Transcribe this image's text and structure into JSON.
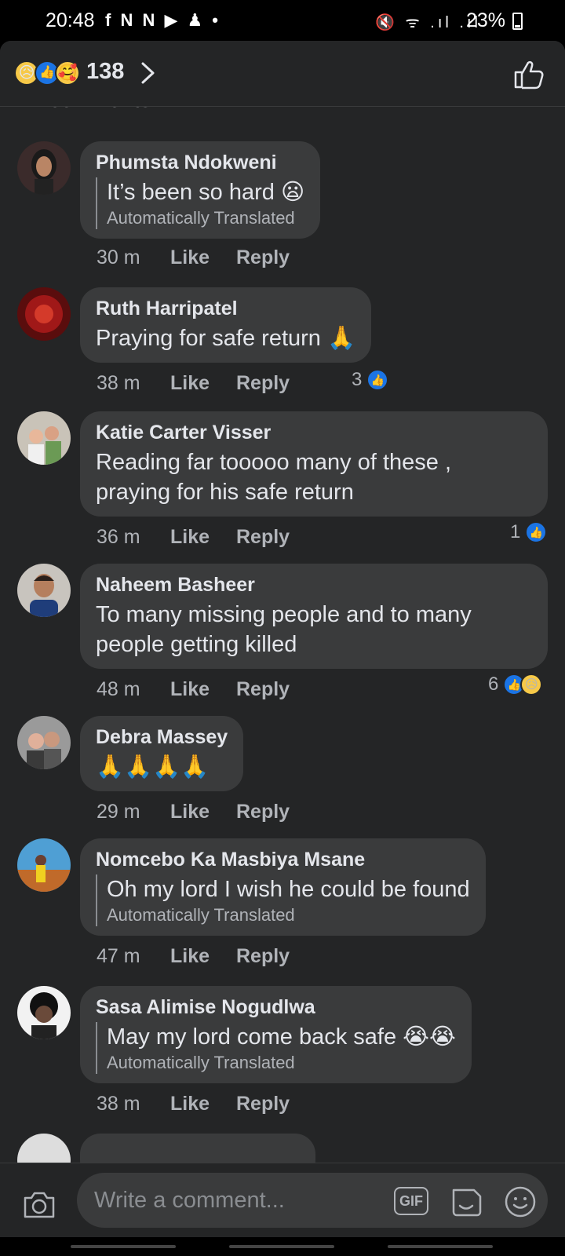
{
  "status_bar": {
    "time": "20:48",
    "app_icons": "f N N ▶ ♟ •",
    "right_icons": "🔇 ᯤ .ıl .ıl",
    "battery": "23%"
  },
  "header": {
    "reaction_count": "138",
    "partial_heading": "All comments"
  },
  "comments": [
    {
      "author": "Phumsta Ndokweni",
      "text": "It’s been so hard 😦",
      "translated": true,
      "translated_note": "Automatically Translated",
      "time": "30 m",
      "like": "Like",
      "reply": "Reply",
      "reaction_count": ""
    },
    {
      "author": "Ruth Harripatel",
      "text": "Praying for safe return 🙏",
      "translated": false,
      "time": "38 m",
      "like": "Like",
      "reply": "Reply",
      "reaction_count": "3"
    },
    {
      "author": "Katie Carter Visser",
      "text": "Reading far tooooo many of these ,",
      "text2": "praying for his safe return",
      "translated": false,
      "time": "36 m",
      "like": "Like",
      "reply": "Reply",
      "reaction_count": "1"
    },
    {
      "author": "Naheem Basheer",
      "text": "To many missing people and to many",
      "text2": "people getting killed",
      "translated": false,
      "time": "48 m",
      "like": "Like",
      "reply": "Reply",
      "reaction_count": "6"
    },
    {
      "author": "Debra Massey",
      "text": "🙏🙏🙏🙏",
      "translated": false,
      "time": "29 m",
      "like": "Like",
      "reply": "Reply",
      "reaction_count": ""
    },
    {
      "author": "Nomcebo Ka Masbiya Msane",
      "text": "Oh my lord I wish he could be found",
      "translated": true,
      "translated_note": "Automatically Translated",
      "time": "47 m",
      "like": "Like",
      "reply": "Reply",
      "reaction_count": ""
    },
    {
      "author": "Sasa Alimise Nogudlwa",
      "text": "May my lord come back safe 😭😭",
      "translated": true,
      "translated_note": "Automatically Translated",
      "time": "38 m",
      "like": "Like",
      "reply": "Reply",
      "reaction_count": ""
    }
  ],
  "composer": {
    "placeholder": "Write a comment...",
    "gif_label": "GIF"
  },
  "colors": {
    "background": "#242526",
    "bubble": "#3a3b3c",
    "like_blue": "#1b74e4",
    "text_primary": "#e4e6eb",
    "text_secondary": "#b0b3b8"
  }
}
